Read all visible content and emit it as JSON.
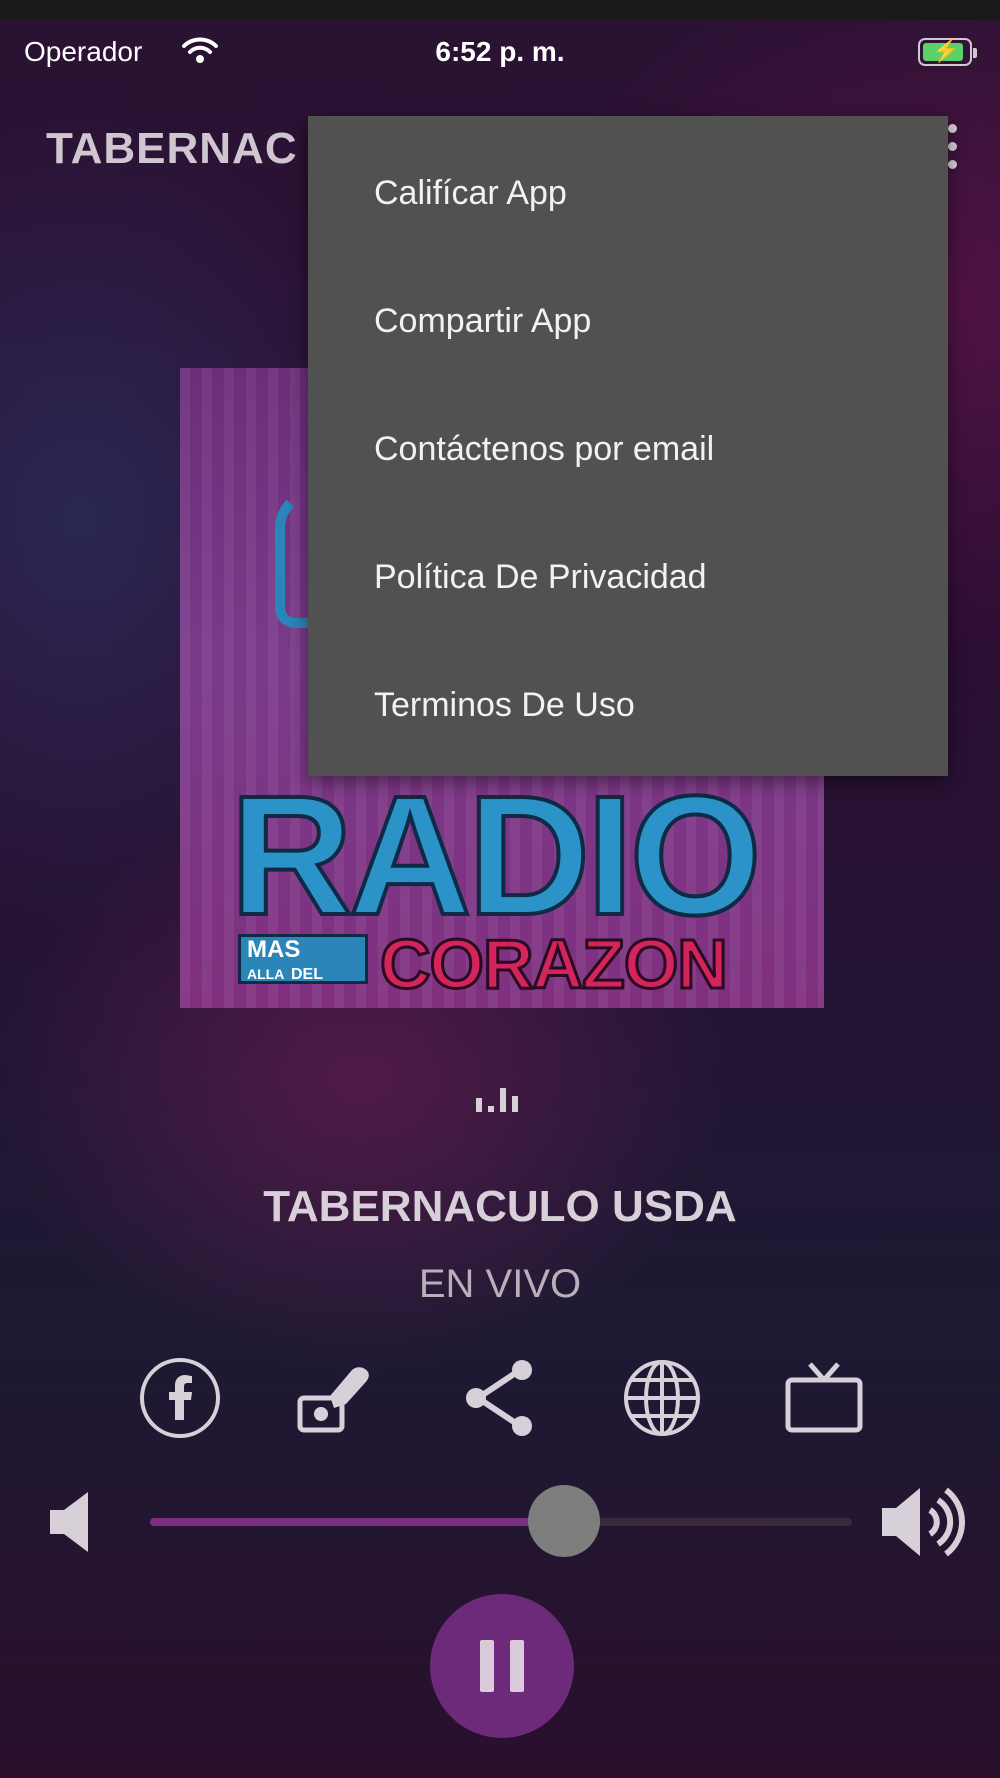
{
  "status_bar": {
    "carrier": "Operador",
    "time": "6:52 p. m."
  },
  "app_bar": {
    "title": "TABERNAC",
    "more_icon": "more-vertical-icon"
  },
  "overflow_menu": {
    "items": [
      {
        "label": "Califícar App"
      },
      {
        "label": "Compartir App"
      },
      {
        "label": "Contáctenos por email"
      },
      {
        "label": "Política De Privacidad"
      },
      {
        "label": "Terminos De Uso"
      }
    ]
  },
  "artwork": {
    "title_word": "RADIO",
    "badge_line1": "MAS",
    "badge_line2": "ALLA",
    "badge_line3": "DEL",
    "subtitle_word": "CORAZON"
  },
  "now_playing": {
    "station": "TABERNACULO USDA",
    "status": "EN VIVO"
  },
  "actions": [
    {
      "icon": "facebook-icon"
    },
    {
      "icon": "donate-icon"
    },
    {
      "icon": "share-icon"
    },
    {
      "icon": "globe-icon"
    },
    {
      "icon": "tv-icon"
    }
  ],
  "volume": {
    "level_fraction": 0.59
  },
  "player": {
    "state_icon": "pause-icon"
  },
  "colors": {
    "accent": "#6e2a7a",
    "menu_bg": "#515151"
  }
}
